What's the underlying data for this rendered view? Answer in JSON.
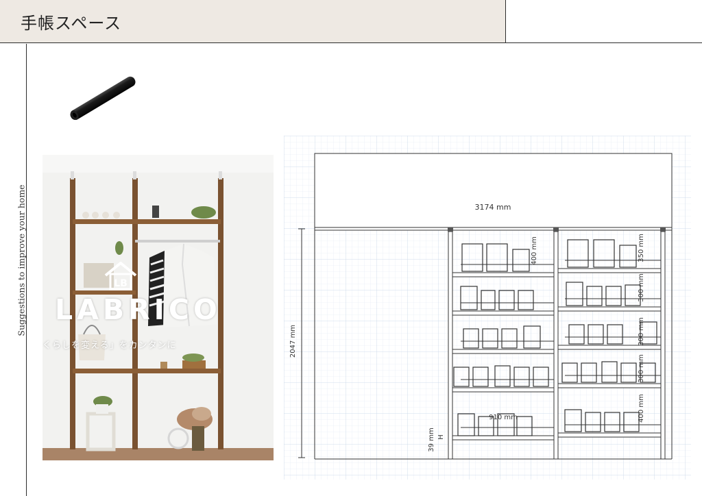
{
  "header": {
    "title": "手帳スペース"
  },
  "sidebar": {
    "caption": "Suggestions to improve your home"
  },
  "photo": {
    "logo_text": "LABRICO",
    "logo_badge": "LB",
    "tagline": "くらしを変える」をカンタンに"
  },
  "plan": {
    "width_label": "3174 mm",
    "height_label": "2047 mm",
    "inner_width_label": "910 mm",
    "base_label": "39 mm",
    "base_marker": "H",
    "left_column_spacing": [
      "400 mm"
    ],
    "right_column_spacing": [
      "350 mm",
      "300 mm",
      "300 mm",
      "300 mm",
      "400 mm"
    ]
  }
}
